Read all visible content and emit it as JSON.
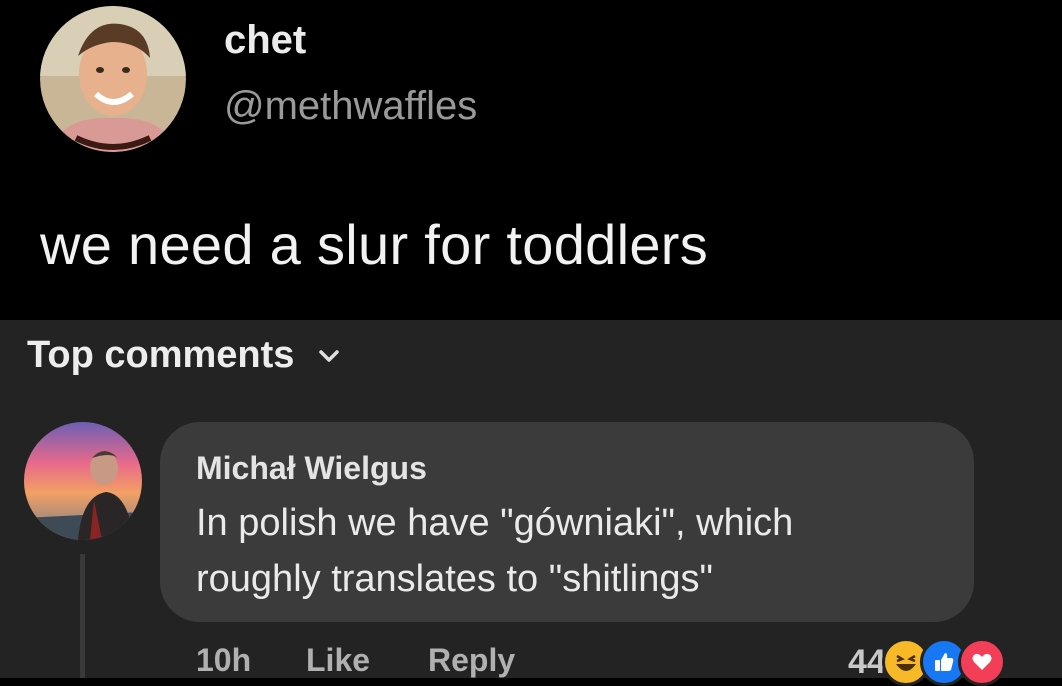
{
  "tweet": {
    "author_name": "chet",
    "author_handle": "@methwaffles",
    "text": "we need a slur for toddlers"
  },
  "comments_section": {
    "sort_label": "Top comments",
    "comment": {
      "author": "Michał Wielgus",
      "lines": [
        "In polish we have \"gówniaki\", which",
        "roughly translates to \"shitlings\""
      ],
      "time": "10h",
      "like_label": "Like",
      "reply_label": "Reply",
      "reaction_count": "44",
      "reactions": [
        "haha-icon",
        "like-icon",
        "love-icon"
      ]
    }
  },
  "colors": {
    "tweet_bg": "#000000",
    "comments_bg": "#232323",
    "bubble_bg": "#3b3b3c",
    "like_blue": "#1877f2",
    "love_red": "#f33e58",
    "haha_yellow": "#f7b928"
  }
}
